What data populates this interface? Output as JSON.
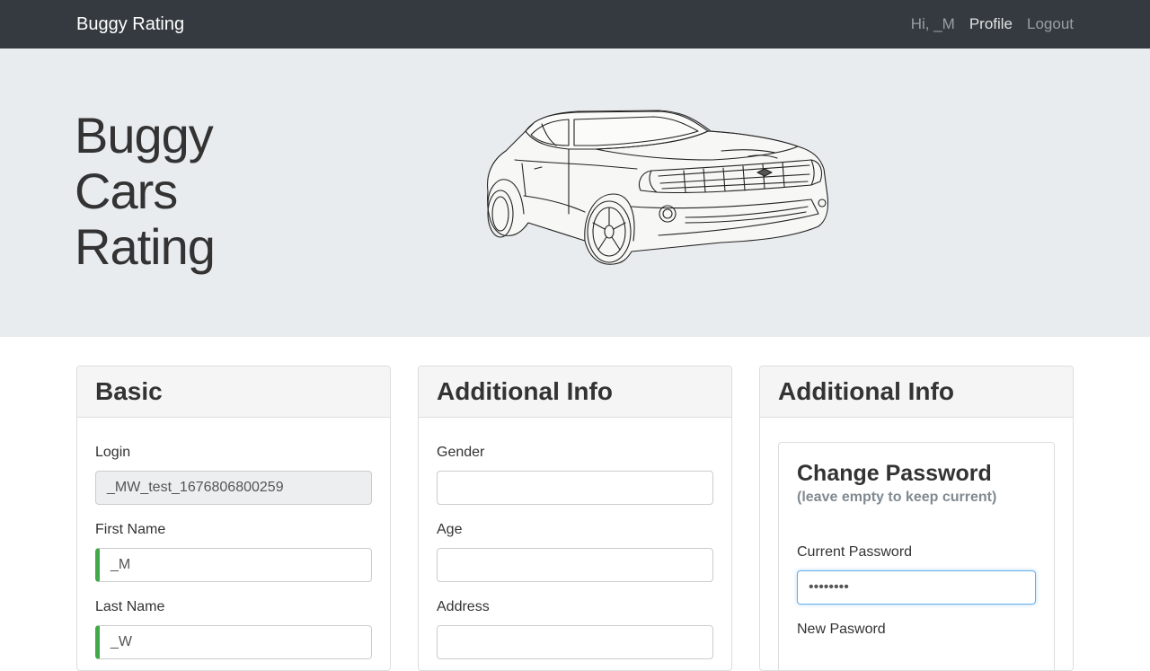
{
  "navbar": {
    "brand": "Buggy Rating",
    "greeting": "Hi, _M",
    "profile": "Profile",
    "logout": "Logout"
  },
  "hero": {
    "title_lines": [
      "Buggy",
      "Cars",
      "Rating"
    ]
  },
  "cards": {
    "basic": {
      "title": "Basic",
      "login_label": "Login",
      "login_value": "_MW_test_1676806800259",
      "first_name_label": "First Name",
      "first_name_value": "_M",
      "last_name_label": "Last Name",
      "last_name_value": "_W"
    },
    "additional": {
      "title": "Additional Info",
      "gender_label": "Gender",
      "gender_value": "",
      "age_label": "Age",
      "age_value": "",
      "address_label": "Address",
      "address_value": ""
    },
    "password": {
      "title": "Additional Info",
      "inner_title": "Change Password",
      "hint": "(leave empty to keep current)",
      "current_label": "Current Password",
      "current_value": "••••••••",
      "new_label": "New Pasword"
    }
  },
  "colors": {
    "navbar_bg": "#343a40",
    "hero_bg": "#e9ecef",
    "valid_green": "#42a948",
    "focus_blue": "#66afe9"
  }
}
